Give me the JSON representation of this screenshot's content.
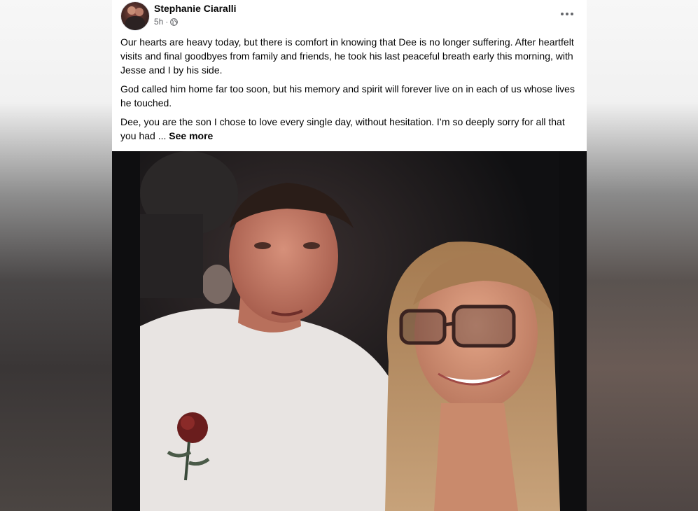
{
  "post": {
    "author": "Stephanie Ciaralli",
    "time": "5h",
    "separator": "·",
    "audience_icon": "globe-icon",
    "more_icon": "more-options-icon",
    "paragraphs": [
      "Our hearts are heavy today, but there is comfort in knowing that Dee is no longer suffering. After heartfelt visits and final goodbyes from family and friends, he took his last peaceful breath early this morning, with Jesse and I by his side.",
      "God called him home far too soon, but his memory and spirit will forever live on in each of us whose lives he touched."
    ],
    "truncated_paragraph": "Dee, you are the son I chose to love every single day, without hesitation. I’m so deeply sorry for all that you had ...",
    "see_more_label": "See more"
  },
  "colors": {
    "text": "#050505",
    "secondary_text": "#65676b",
    "background": "#ffffff"
  }
}
